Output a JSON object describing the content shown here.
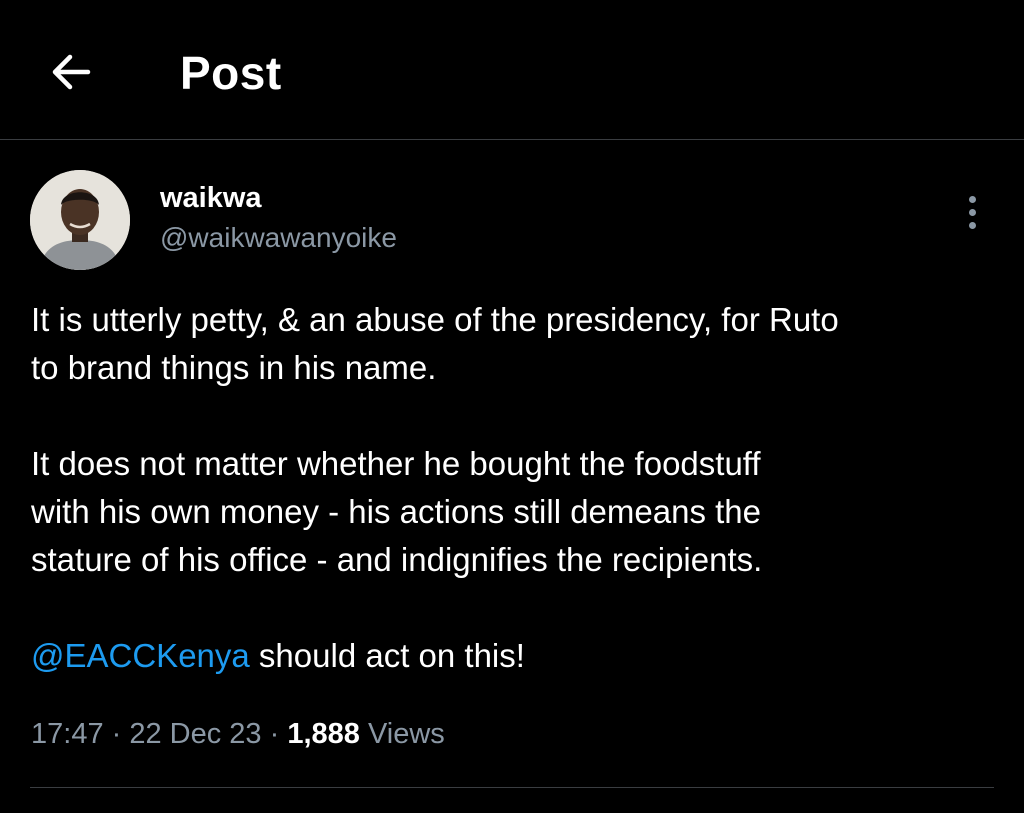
{
  "header": {
    "title": "Post",
    "back_icon": "arrow-left-icon"
  },
  "author": {
    "display_name": "waikwa",
    "handle": "@waikwawanyoike",
    "avatar_icon": "profile-photo"
  },
  "tweet": {
    "paragraph1_line1": "It is utterly petty, & an abuse of the presidency, for Ruto",
    "paragraph1_line2": "to brand things in his name.",
    "paragraph2_line1": "It does not matter whether he bought the foodstuff",
    "paragraph2_line2": "with his own money - his actions still demeans the",
    "paragraph2_line3": "stature of his office - and indignifies the recipients.",
    "mention": "@EACCKenya",
    "mention_suffix": " should act on this!"
  },
  "meta": {
    "time": "17:47",
    "separator": " · ",
    "date": "22 Dec 23",
    "views_count": "1,888",
    "views_label": " Views"
  },
  "colors": {
    "background": "#000000",
    "text": "#ffffff",
    "secondary": "#8b98a5",
    "link": "#1d9bf0",
    "divider": "#3a3d41"
  }
}
